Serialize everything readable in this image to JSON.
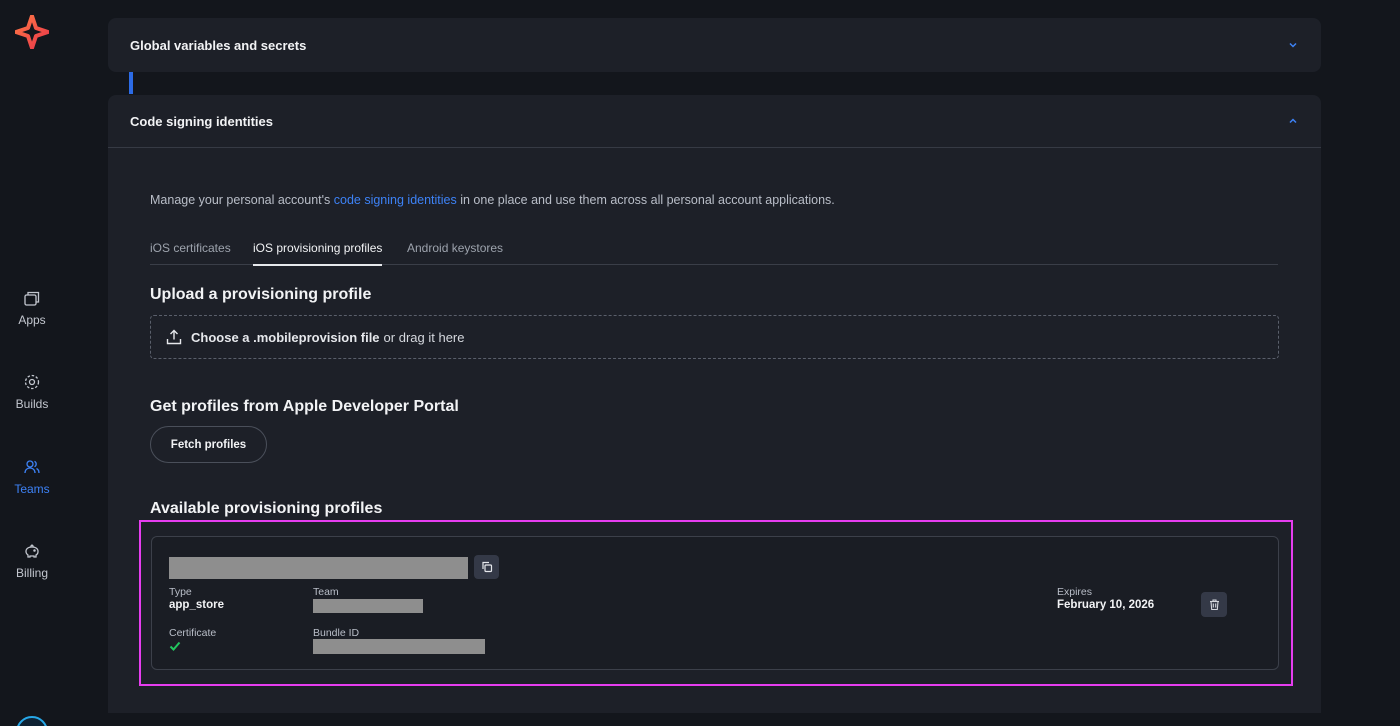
{
  "sidebar": {
    "items": [
      {
        "label": "Apps",
        "icon": "apps-icon"
      },
      {
        "label": "Builds",
        "icon": "builds-icon"
      },
      {
        "label": "Teams",
        "icon": "teams-icon",
        "active": true
      },
      {
        "label": "Billing",
        "icon": "billing-icon"
      }
    ]
  },
  "panels": {
    "global_vars": {
      "title": "Global variables and secrets"
    },
    "code_signing": {
      "title": "Code signing identities"
    }
  },
  "description": {
    "before": "Manage your personal account's ",
    "link": "code signing identities",
    "after": " in one place and use them across all personal account applications."
  },
  "tabs": [
    {
      "label": "iOS certificates"
    },
    {
      "label": "iOS provisioning profiles",
      "active": true
    },
    {
      "label": "Android keystores"
    }
  ],
  "upload": {
    "heading": "Upload a provisioning profile",
    "choose_label": "Choose a .mobileprovision file",
    "drag_label": "or drag it here"
  },
  "apple": {
    "heading": "Get profiles from Apple Developer Portal",
    "fetch_button": "Fetch profiles"
  },
  "available": {
    "heading": "Available provisioning profiles",
    "profile": {
      "type_label": "Type",
      "type_value": "app_store",
      "team_label": "Team",
      "certificate_label": "Certificate",
      "bundle_label": "Bundle ID",
      "expires_label": "Expires",
      "expires_value": "February 10, 2026"
    }
  },
  "colors": {
    "accent": "#3d82f6",
    "highlight": "#e63df0",
    "success": "#22c55e",
    "logo_orange": "#f26b3a"
  }
}
